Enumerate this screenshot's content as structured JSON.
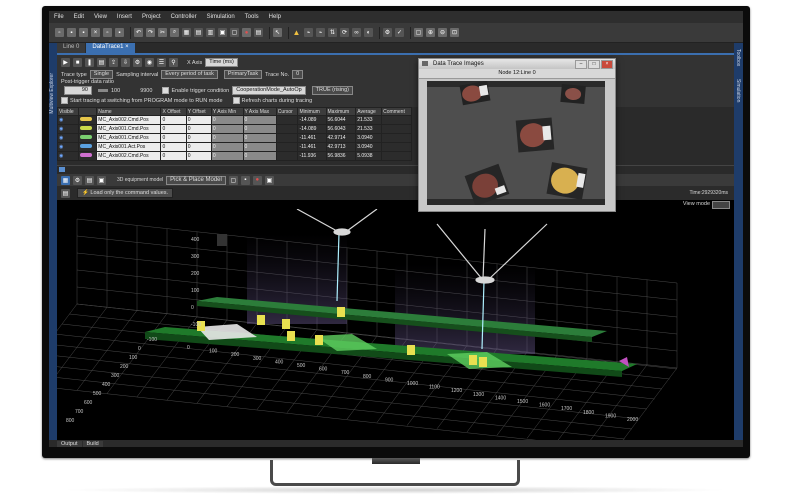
{
  "menu": [
    "File",
    "Edit",
    "View",
    "Insert",
    "Project",
    "Controller",
    "Simulation",
    "Tools",
    "Help"
  ],
  "tabs": [
    {
      "label": "Line 0"
    },
    {
      "label": "DataTrace1"
    }
  ],
  "left_strip_label": "Multiview Explorer",
  "right_strip": {
    "top": "Toolbox",
    "bottom": "Simulation"
  },
  "axis_control": {
    "label": "X Axis",
    "value": "Time (ms)"
  },
  "trace": {
    "type_label": "Trace type",
    "type_value": "Single",
    "interval_label": "Sampling interval",
    "interval_value": "Every period of task",
    "task_value": "PrimaryTask",
    "trace_no_label": "Trace No.",
    "trace_no_value": "0",
    "post_trigger_label": "Post-trigger data ratio",
    "post_trigger_value": "90",
    "post_trigger_min": "100",
    "post_trigger_max": "9900",
    "enable_trigger_label": "Enable trigger condition",
    "trigger_value": "CooperationMode_AutoOp",
    "trigger_mode": "TRUE (rising)",
    "start_switch_label": "Start tracing at switching from PROGRAM mode to RUN mode",
    "refresh_label": "Refresh charts during tracing"
  },
  "grid": {
    "headers": [
      "Visible",
      "",
      "Name",
      "X Offset",
      "Y Offset",
      "Y Axis Min",
      "Y Axis Max",
      "Cursor",
      "Minimum",
      "Maximum",
      "Average",
      "Comment"
    ],
    "rows": [
      {
        "color": "#e6c64a",
        "name": "MC_Axis002.Cmd.Pos",
        "xoff": "0",
        "yoff": "0",
        "ymin": "0",
        "ymax": "0",
        "min": "-14.089",
        "max": "56.6044",
        "avg": "21.533"
      },
      {
        "color": "#c9d84a",
        "name": "MC_Axis001.Cmd.Pos",
        "xoff": "0",
        "yoff": "0",
        "ymin": "0",
        "ymax": "0",
        "min": "-14.089",
        "max": "56.6043",
        "avg": "21.533"
      },
      {
        "color": "#7ad070",
        "name": "MC_Axis001.Cmd.Pos",
        "xoff": "0",
        "yoff": "0",
        "ymin": "0",
        "ymax": "0",
        "min": "-11.461",
        "max": "42.9714",
        "avg": "3.0940"
      },
      {
        "color": "#5aa0e0",
        "name": "MC_Axis001.Act.Pos",
        "xoff": "0",
        "yoff": "0",
        "ymin": "0",
        "ymax": "0",
        "min": "-11.461",
        "max": "42.9713",
        "avg": "3.0940"
      },
      {
        "color": "#d070d0",
        "name": "MC_Axis002.Cmd.Pos",
        "xoff": "0",
        "yoff": "0",
        "ymin": "0",
        "ymax": "0",
        "min": "-11.936",
        "max": "56.9836",
        "avg": "5.0938"
      }
    ]
  },
  "sim_toolbar": {
    "model_label": "3D equipment model",
    "model_value": "Pick & Place Model"
  },
  "command": {
    "label": "Load only the command values."
  },
  "time_readout": "Time:2929320ms",
  "view_mode_label": "View mode",
  "popup": {
    "title": "Data Trace Images",
    "subtitle": "Node 12:Line 0"
  },
  "axis_labels": {
    "z": [
      "400",
      "300",
      "200",
      "100",
      "0",
      "-100"
    ],
    "x": [
      "0",
      "100",
      "200",
      "300",
      "400",
      "500",
      "600",
      "700",
      "800",
      "900",
      "1000",
      "1100",
      "1200",
      "1300",
      "1400",
      "1500",
      "1600",
      "1700",
      "1800",
      "1900",
      "2000"
    ],
    "left": [
      "-100",
      "0",
      "100",
      "200",
      "300",
      "400",
      "500",
      "600",
      "700",
      "800"
    ]
  },
  "bottom_tabs": [
    "Output",
    "Build"
  ],
  "colors": {
    "accent": "#3b6fb0",
    "conveyor": "#2e8a3a",
    "workpiece": "#e8e050"
  }
}
